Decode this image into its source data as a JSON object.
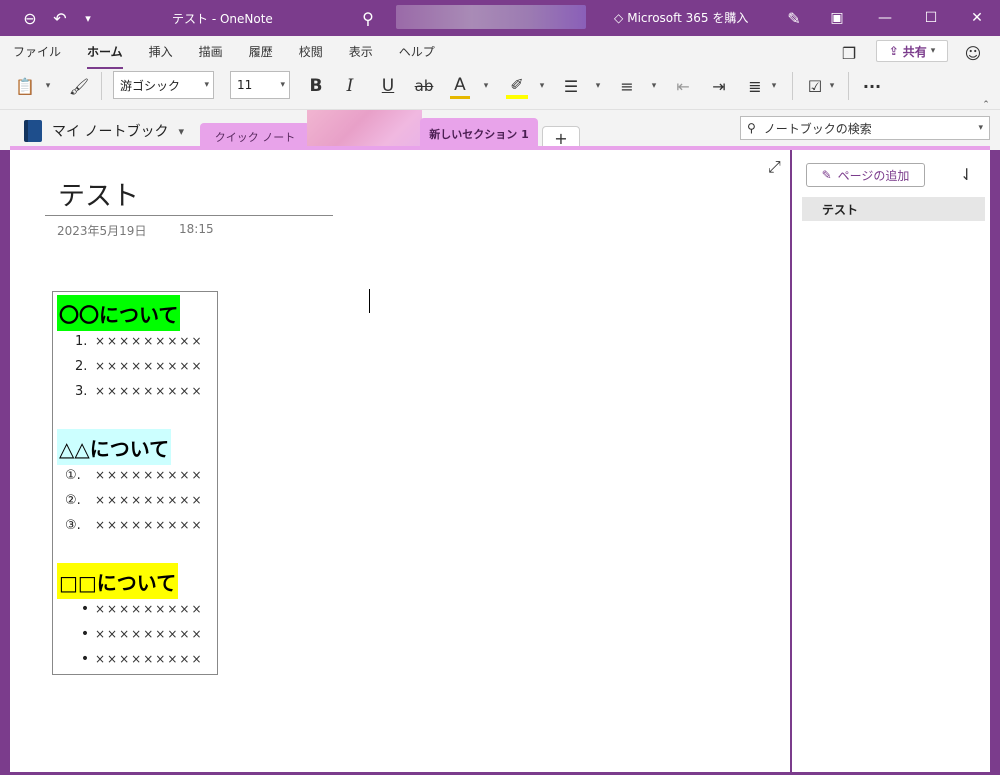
{
  "titlebar": {
    "title": "テスト  -  OneNote",
    "ms365": "Microsoft 365 を購入"
  },
  "ribbon": {
    "menu": [
      "ファイル",
      "ホーム",
      "挿入",
      "描画",
      "履歴",
      "校閲",
      "表示",
      "ヘルプ"
    ],
    "active_menu": "ホーム",
    "share_label": "共有",
    "font_name": "游ゴシック",
    "font_size": "11",
    "more": "···"
  },
  "notebook": {
    "name": "マイ ノートブック",
    "tabs": {
      "quick": "クイック ノート",
      "active": "新しいセクション 1",
      "add": "+"
    },
    "search_placeholder": "ノートブックの検索"
  },
  "page": {
    "title": "テスト",
    "date": "2023年5月19日",
    "time": "18:15",
    "sections": [
      {
        "heading": "〇〇について",
        "items": [
          {
            "marker": "1.",
            "text": "×××××××××"
          },
          {
            "marker": "2.",
            "text": "×××××××××"
          },
          {
            "marker": "3.",
            "text": "×××××××××"
          }
        ]
      },
      {
        "heading": "△△について",
        "items": [
          {
            "marker": "①.",
            "text": "×××××××××"
          },
          {
            "marker": "②.",
            "text": "×××××××××"
          },
          {
            "marker": "③.",
            "text": "×××××××××"
          }
        ]
      },
      {
        "heading": "□□について",
        "items": [
          {
            "marker": "•",
            "text": "×××××××××"
          },
          {
            "marker": "•",
            "text": "×××××××××"
          },
          {
            "marker": "•",
            "text": "×××××××××"
          }
        ]
      }
    ]
  },
  "pages_pane": {
    "add_page": "ページの追加",
    "pages": [
      "テスト"
    ]
  },
  "colors": {
    "accent": "#7b3c8c",
    "section_tab": "#e8a3ea",
    "highlight_green": "#00ff00",
    "highlight_cyan": "#ccffff",
    "highlight_yellow": "#ffff00"
  }
}
